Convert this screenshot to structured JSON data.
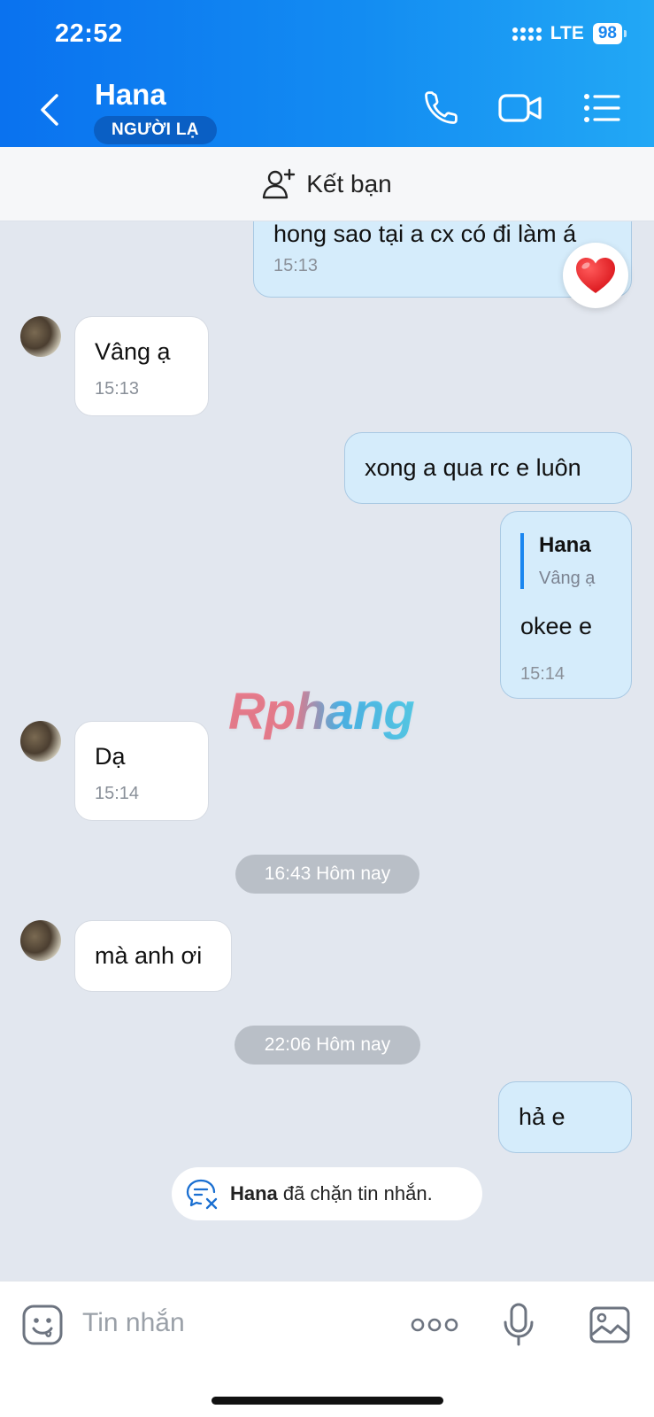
{
  "status_bar": {
    "time": "22:52",
    "network": "LTE",
    "battery": "98"
  },
  "header": {
    "name": "Hana",
    "badge": "NGƯỜI LẠ"
  },
  "friend_bar": {
    "label": "Kết bạn"
  },
  "messages": [
    {
      "text": "hong sao tại a cx có đi làm á",
      "time": "15:13"
    },
    {
      "text": "Vâng ạ",
      "time": "15:13"
    },
    {
      "text": "xong a qua rc e luôn"
    },
    {
      "quote_name": "Hana",
      "quote_text": "Vâng ạ",
      "text": "okee e",
      "time": "15:14"
    },
    {
      "text": "Dạ",
      "time": "15:14"
    },
    {
      "text": "mà anh ơi"
    },
    {
      "text": "hả e"
    }
  ],
  "separators": [
    "16:43 Hôm nay",
    "22:06 Hôm nay"
  ],
  "watermark": "Rphang",
  "blocked_notice": {
    "name": "Hana",
    "text": " đã chặn tin nhắn."
  },
  "input": {
    "placeholder": "Tin nhắn"
  },
  "colors": {
    "header_start": "#0a72ef",
    "header_end": "#22a8f5",
    "outgoing_bubble": "#d5ecfb",
    "accent": "#1a86f0"
  },
  "icons": [
    "back-icon",
    "phone-icon",
    "video-call-icon",
    "menu-list-icon",
    "add-friend-icon",
    "heart-reaction-icon",
    "blocked-message-icon",
    "sticker-icon",
    "more-icon",
    "microphone-icon",
    "image-icon"
  ]
}
